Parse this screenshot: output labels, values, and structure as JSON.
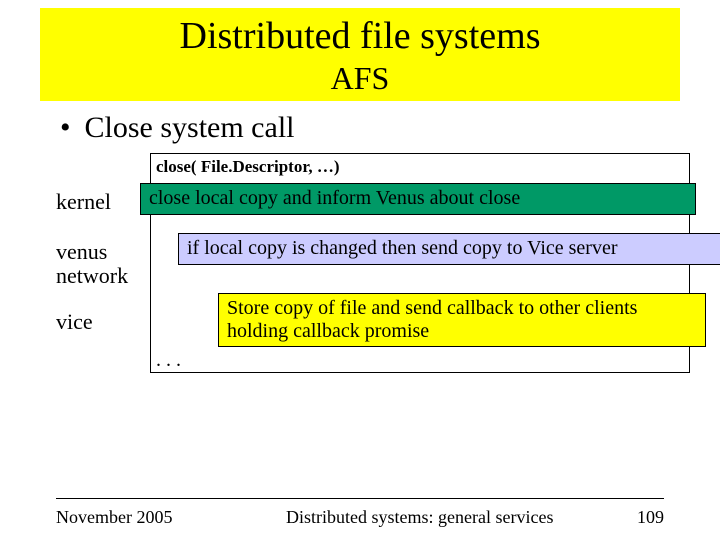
{
  "title": {
    "main": "Distributed file systems",
    "sub": "AFS"
  },
  "bullet": {
    "dot": "•",
    "text": "Close system call"
  },
  "diagram": {
    "close_call": "close( File.Descriptor, …)",
    "labels": {
      "kernel": "kernel",
      "venus": "venus",
      "network": "network",
      "vice": "vice"
    },
    "boxes": {
      "kernel": "close local copy and inform Venus about close",
      "venus": "if local copy is changed then send copy  to Vice server",
      "vice": "Store copy of file and send callback to other clients holding callback promise"
    },
    "dots": ". . ."
  },
  "footer": {
    "left": "November 2005",
    "center": "Distributed systems: general services",
    "right": "109"
  }
}
